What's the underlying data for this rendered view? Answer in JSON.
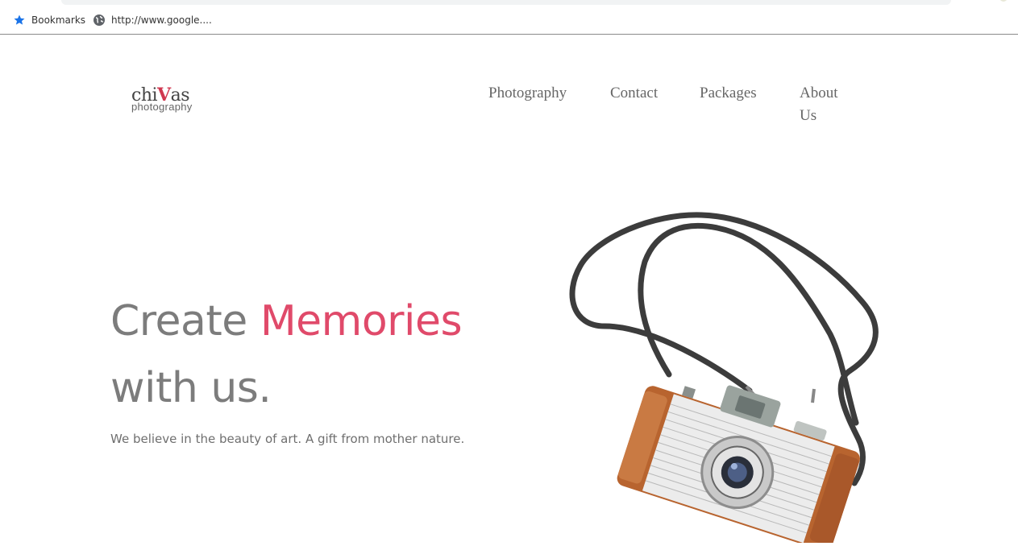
{
  "browser": {
    "bookmarks_label": "Bookmarks",
    "bookmark_link": "http://www.google...."
  },
  "brand": {
    "logo_text_pre": "chi",
    "logo_text_v": "V",
    "logo_text_post": "as",
    "logo_sub": "photography",
    "accent_color": "#e04a6a"
  },
  "nav": {
    "items": [
      "Photography",
      "Contact",
      "Packages",
      "About"
    ],
    "about_second_line": "Us"
  },
  "hero": {
    "title_part1": "Create ",
    "title_accent": "Memories",
    "title_line2": "with us.",
    "subtitle": "We believe in the beauty of art. A gift from mother nature.",
    "image": "vintage-camera-photo"
  }
}
